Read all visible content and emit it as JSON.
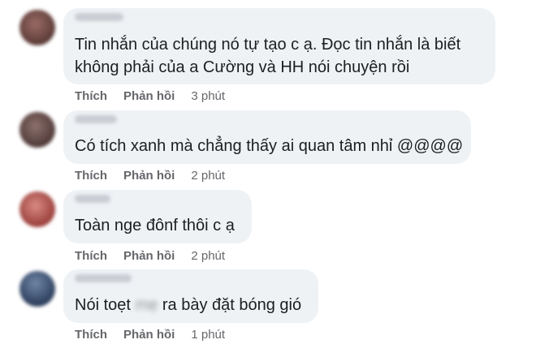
{
  "comments": [
    {
      "avatar_color": "#7a4f4a",
      "lines": [
        "Tin nhắn của chúng nó tự tạo c ạ. Đọc tin nhắn là biết",
        "không phải của a Cường và HH nói chuyện rồi"
      ],
      "like_label": "Thích",
      "reply_label": "Phản hồi",
      "time": "3 phút"
    },
    {
      "avatar_color": "#6e5552",
      "lines": [
        "Có tích xanh mà chẳng thấy ai quan tâm nhỉ @@@@"
      ],
      "like_label": "Thích",
      "reply_label": "Phản hồi",
      "time": "2 phút"
    },
    {
      "avatar_color": "#b5534f",
      "lines": [
        "Toàn nge đônf thôi c ạ"
      ],
      "like_label": "Thích",
      "reply_label": "Phản hồi",
      "time": "2 phút"
    },
    {
      "avatar_color": "#3d5272",
      "text_before": "Nói toẹt",
      "text_blurred": "mẹ",
      "text_after": "ra bày đặt bóng gió",
      "like_label": "Thích",
      "reply_label": "Phản hồi",
      "time": "1 phút"
    }
  ]
}
